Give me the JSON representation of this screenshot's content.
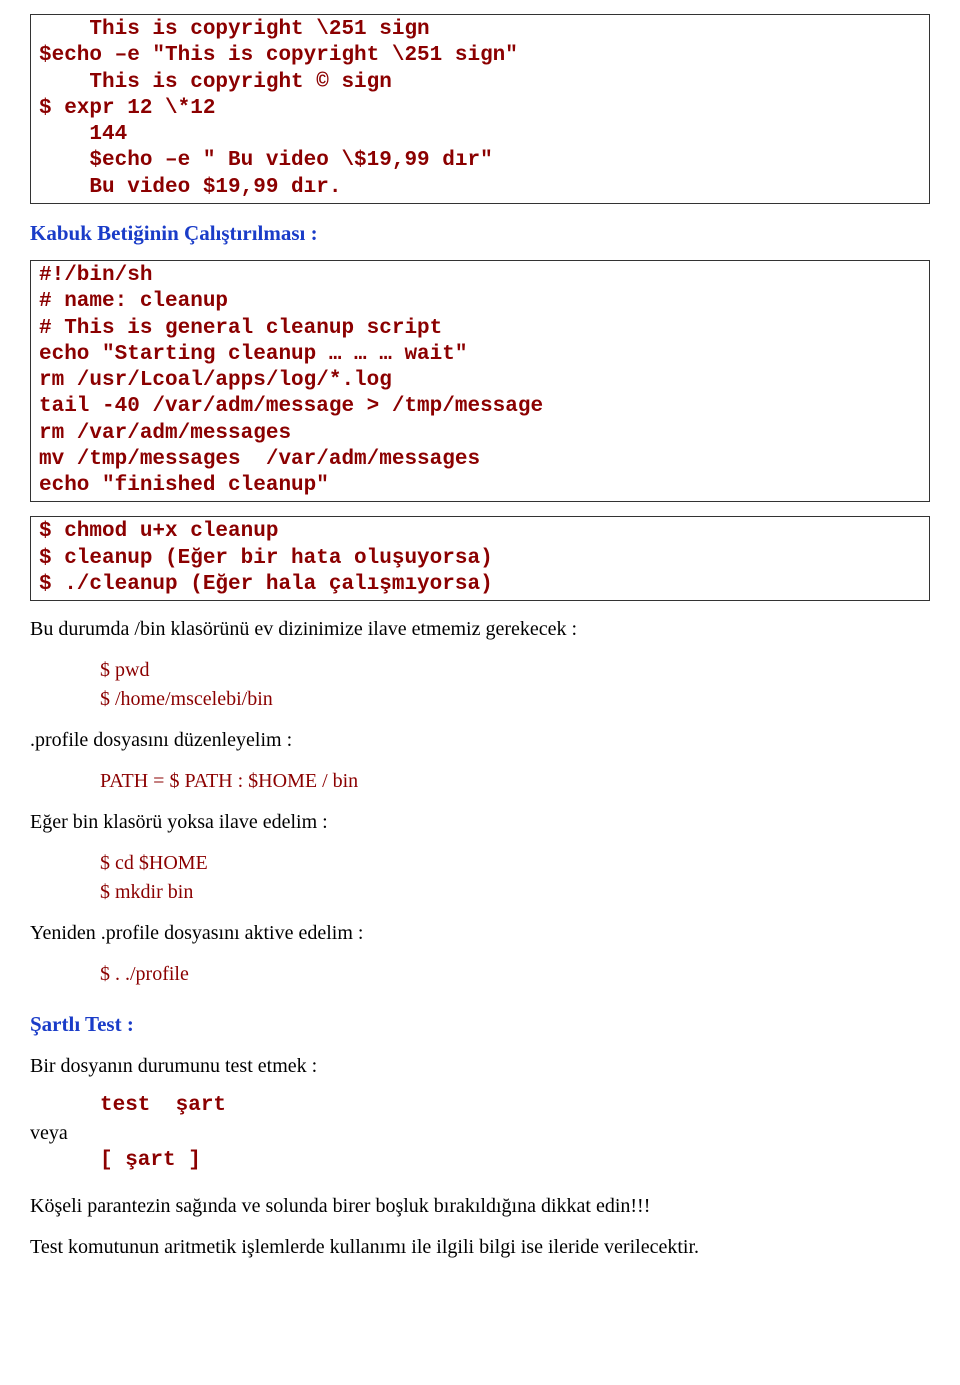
{
  "box1_lines": "    This is copyright \\251 sign\n$echo –e \"This is copyright \\251 sign\"\n    This is copyright © sign\n$ expr 12 \\*12\n    144\n    $echo –e \" Bu video \\$19,99 dır\"\n    Bu video $19,99 dır.",
  "heading1": "Kabuk Betiğinin Çalıştırılması :",
  "box2_lines": "#!/bin/sh\n# name: cleanup\n# This is general cleanup script\necho \"Starting cleanup … … … wait\"\nrm /usr/Lcoal/apps/log/*.log\ntail -40 /var/adm/message > /tmp/message\nrm /var/adm/messages\nmv /tmp/messages  /var/adm/messages\necho \"finished cleanup\"",
  "box3_lines": "$ chmod u+x cleanup\n$ cleanup (Eğer bir hata oluşuyorsa)\n$ ./cleanup (Eğer hala çalışmıyorsa)",
  "para1": "Bu durumda /bin klasörünü ev dizinimize ilave etmemiz gerekecek :",
  "cmd1_line1": "$ pwd",
  "cmd1_line2": "$ /home/mscelebi/bin",
  "para2": ".profile dosyasını düzenleyelim :",
  "cmd2_line1": "PATH = $ PATH : $HOME / bin",
  "para3": "Eğer bin klasörü yoksa ilave edelim :",
  "cmd3_line1": "$ cd $HOME",
  "cmd3_line2": "$ mkdir bin",
  "para4": "Yeniden .profile dosyasını aktive edelim :",
  "cmd4_line1": "$ . ./profile",
  "heading2": "Şartlı Test :",
  "para5": "Bir dosyanın durumunu test etmek :",
  "test_line1": "test  şart",
  "veya": "veya",
  "test_line2": "[ şart ]",
  "para6": "Köşeli parantezin sağında ve solunda birer boşluk bırakıldığına dikkat edin!!!",
  "para7": "Test komutunun aritmetik işlemlerde kullanımı ile ilgili bilgi ise ileride verilecektir."
}
